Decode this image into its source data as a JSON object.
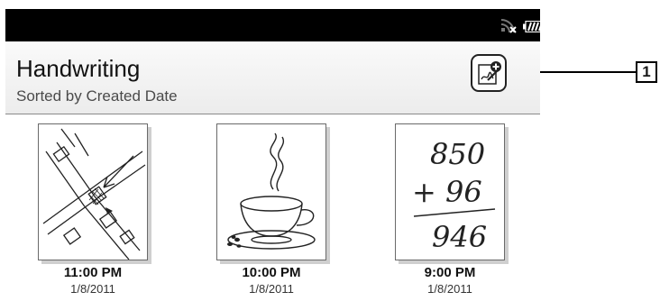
{
  "header": {
    "title": "Handwriting",
    "subtitle": "Sorted by Created Date"
  },
  "statusbar": {
    "icons": [
      "wifi-off-icon",
      "battery-icon"
    ]
  },
  "toolbar": {
    "new_note_icon": "new-handwriting-icon"
  },
  "notes": [
    {
      "time": "11:00 PM",
      "date": "1/8/2011",
      "thumbnail": "map-sketch"
    },
    {
      "time": "10:00 PM",
      "date": "1/8/2011",
      "thumbnail": "coffee-cup-sketch"
    },
    {
      "time": "9:00 PM",
      "date": "1/8/2011",
      "thumbnail": "arithmetic-sketch"
    }
  ],
  "thumb_texts": {
    "line1": "850",
    "line2": "+ 96",
    "line3": "946"
  },
  "callout": {
    "label": "1"
  },
  "colors": {
    "statusbar": "#000000",
    "header_bg": "#f2f2f2",
    "divider": "#8a8a8a"
  }
}
